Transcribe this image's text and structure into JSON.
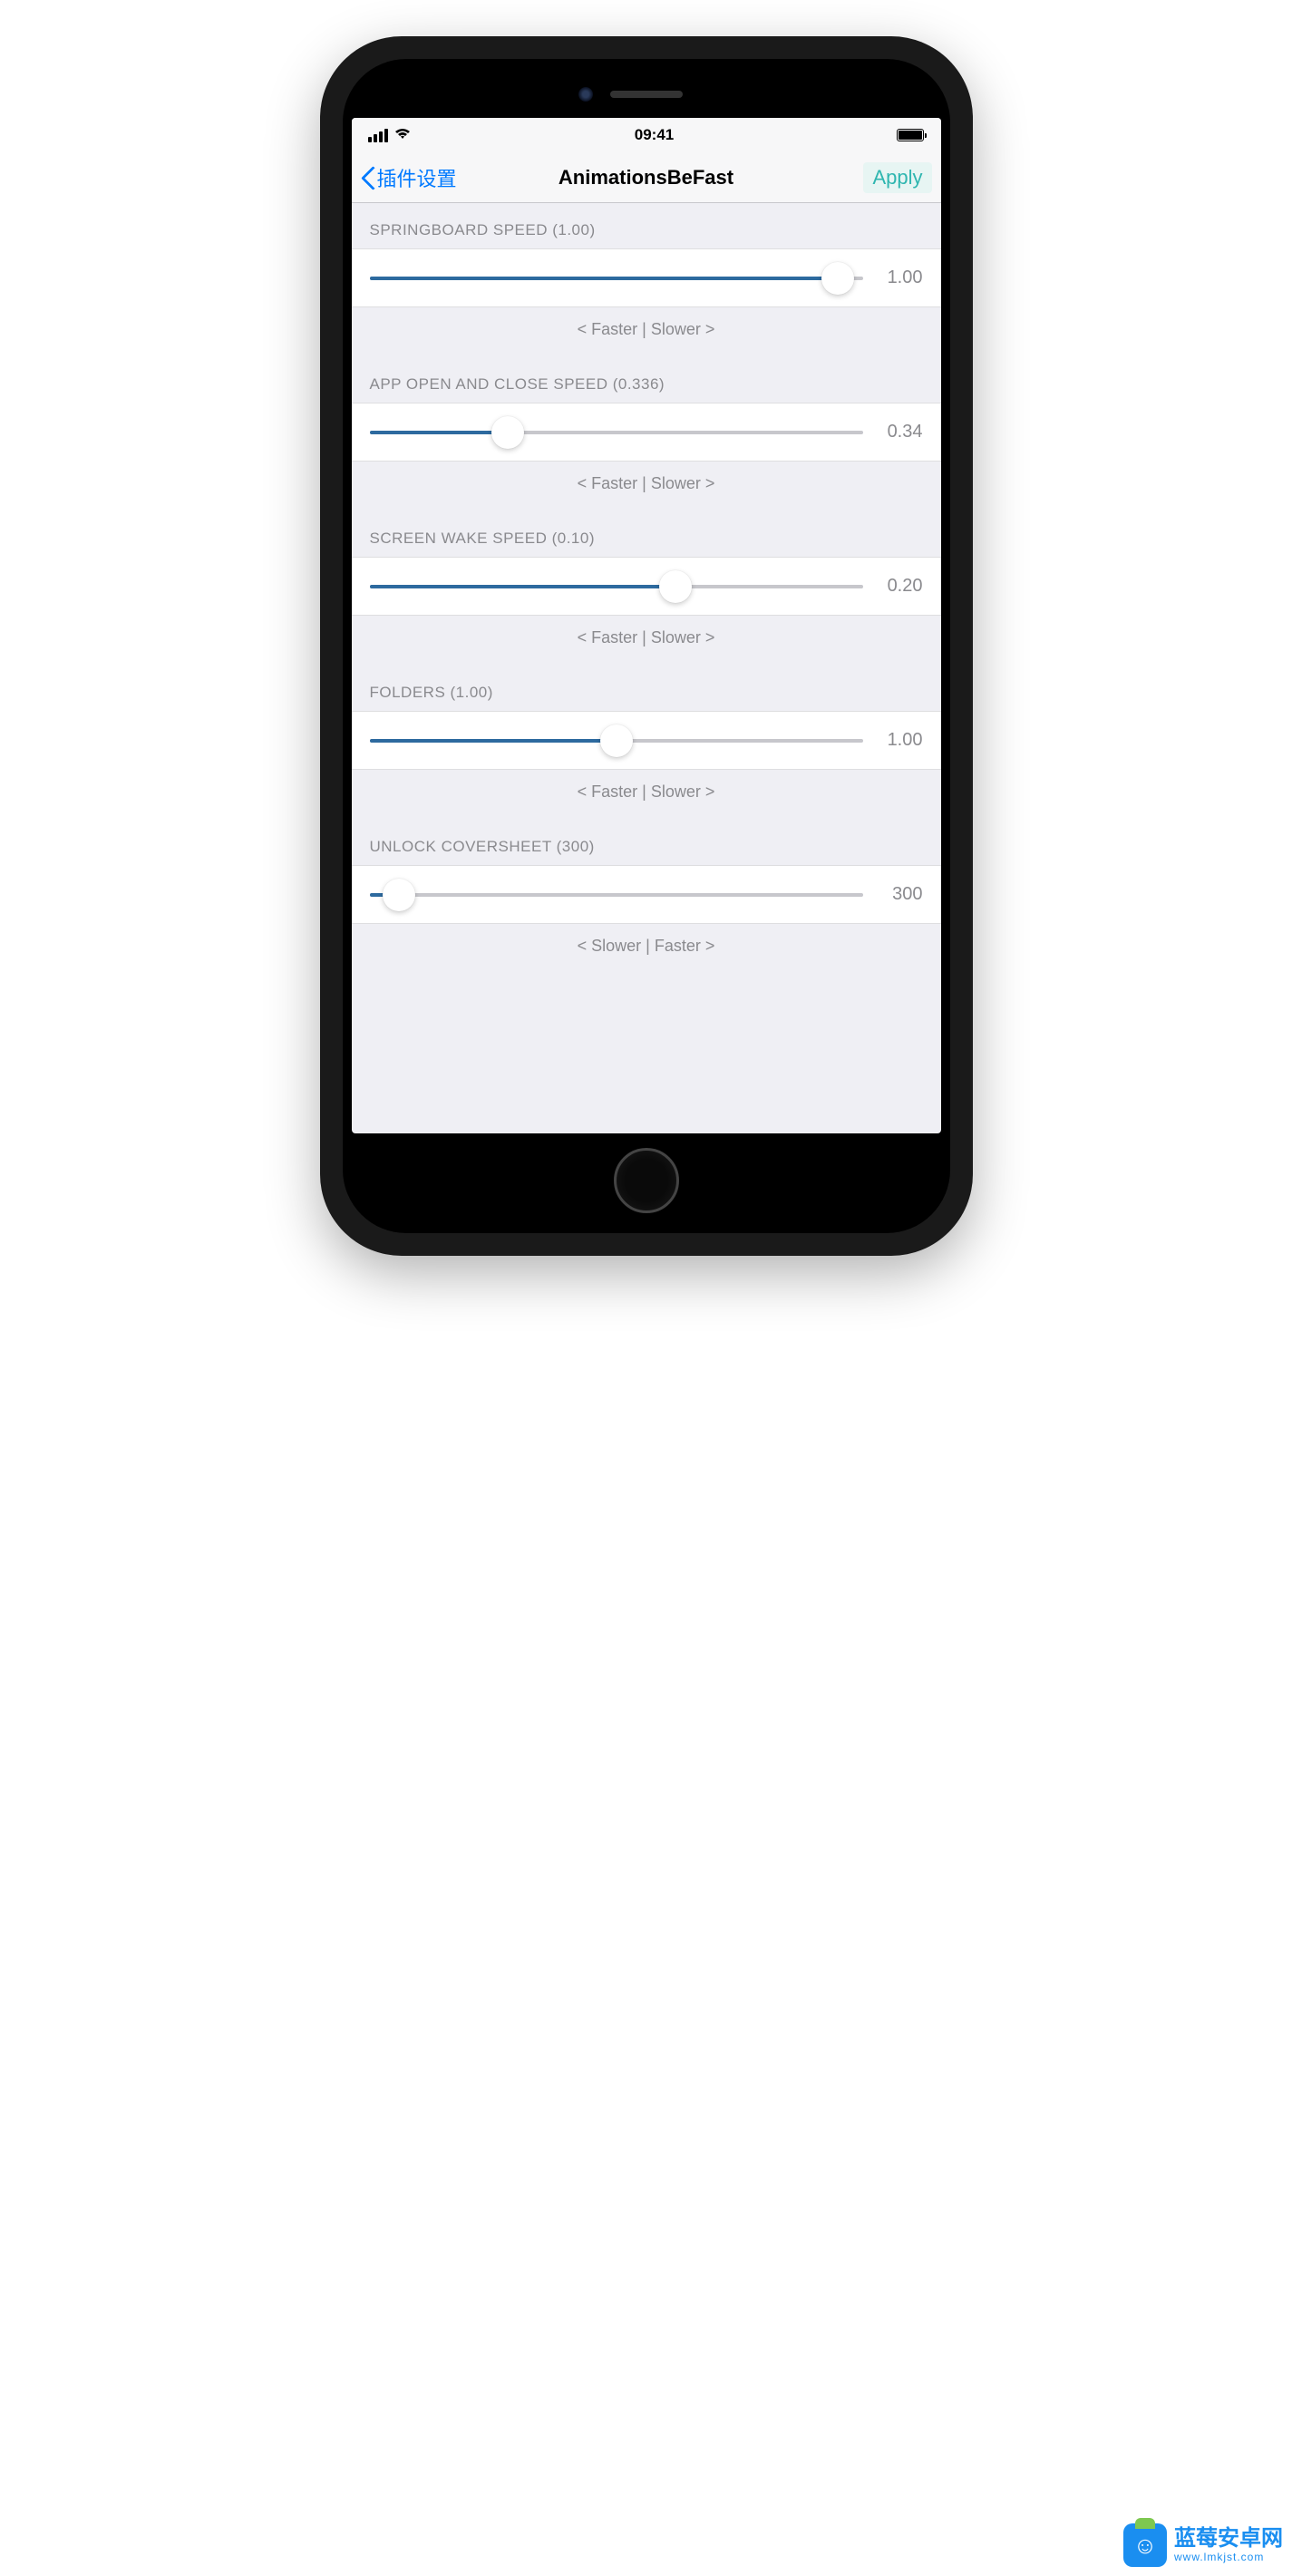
{
  "status_bar": {
    "time": "09:41"
  },
  "nav": {
    "back_label": "插件设置",
    "title": "AnimationsBeFast",
    "action_label": "Apply"
  },
  "sections": [
    {
      "header": "SPRINGBOARD SPEED (1.00)",
      "value_display": "1.00",
      "fill_percent": 95,
      "footer": "< Faster | Slower >"
    },
    {
      "header": "APP OPEN AND CLOSE SPEED (0.336)",
      "value_display": "0.34",
      "fill_percent": 28,
      "footer": "< Faster | Slower >"
    },
    {
      "header": "SCREEN WAKE SPEED (0.10)",
      "value_display": "0.20",
      "fill_percent": 62,
      "footer": "< Faster | Slower >"
    },
    {
      "header": "FOLDERS (1.00)",
      "value_display": "1.00",
      "fill_percent": 50,
      "footer": "< Faster | Slower >"
    },
    {
      "header": "UNLOCK COVERSHEET (300)",
      "value_display": "300",
      "fill_percent": 6,
      "footer": "< Slower | Faster >"
    }
  ],
  "watermark": {
    "title": "蓝莓安卓网",
    "sub": "www.lmkjst.com"
  }
}
